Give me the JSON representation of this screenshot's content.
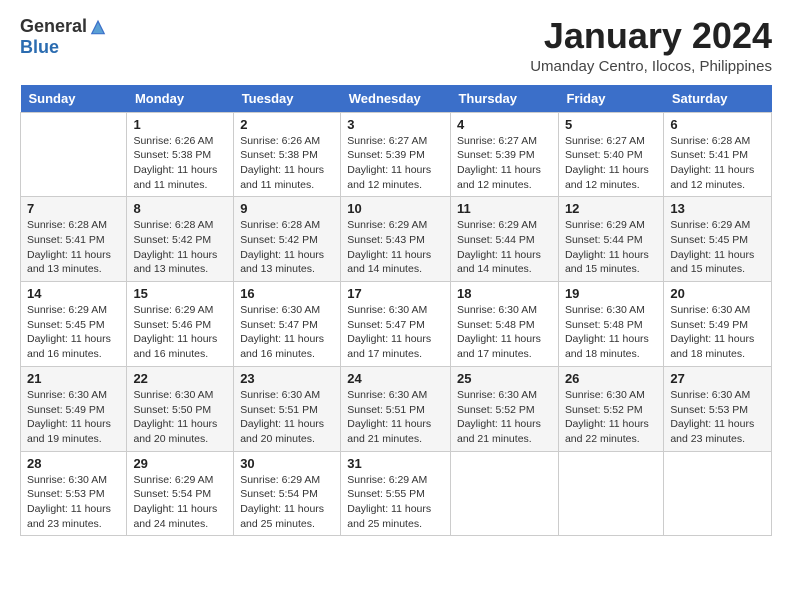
{
  "logo": {
    "general": "General",
    "blue": "Blue"
  },
  "title": "January 2024",
  "subtitle": "Umanday Centro, Ilocos, Philippines",
  "days_of_week": [
    "Sunday",
    "Monday",
    "Tuesday",
    "Wednesday",
    "Thursday",
    "Friday",
    "Saturday"
  ],
  "weeks": [
    [
      {
        "day": "",
        "info": ""
      },
      {
        "day": "1",
        "info": "Sunrise: 6:26 AM\nSunset: 5:38 PM\nDaylight: 11 hours and 11 minutes."
      },
      {
        "day": "2",
        "info": "Sunrise: 6:26 AM\nSunset: 5:38 PM\nDaylight: 11 hours and 11 minutes."
      },
      {
        "day": "3",
        "info": "Sunrise: 6:27 AM\nSunset: 5:39 PM\nDaylight: 11 hours and 12 minutes."
      },
      {
        "day": "4",
        "info": "Sunrise: 6:27 AM\nSunset: 5:39 PM\nDaylight: 11 hours and 12 minutes."
      },
      {
        "day": "5",
        "info": "Sunrise: 6:27 AM\nSunset: 5:40 PM\nDaylight: 11 hours and 12 minutes."
      },
      {
        "day": "6",
        "info": "Sunrise: 6:28 AM\nSunset: 5:41 PM\nDaylight: 11 hours and 12 minutes."
      }
    ],
    [
      {
        "day": "7",
        "info": "Sunrise: 6:28 AM\nSunset: 5:41 PM\nDaylight: 11 hours and 13 minutes."
      },
      {
        "day": "8",
        "info": "Sunrise: 6:28 AM\nSunset: 5:42 PM\nDaylight: 11 hours and 13 minutes."
      },
      {
        "day": "9",
        "info": "Sunrise: 6:28 AM\nSunset: 5:42 PM\nDaylight: 11 hours and 13 minutes."
      },
      {
        "day": "10",
        "info": "Sunrise: 6:29 AM\nSunset: 5:43 PM\nDaylight: 11 hours and 14 minutes."
      },
      {
        "day": "11",
        "info": "Sunrise: 6:29 AM\nSunset: 5:44 PM\nDaylight: 11 hours and 14 minutes."
      },
      {
        "day": "12",
        "info": "Sunrise: 6:29 AM\nSunset: 5:44 PM\nDaylight: 11 hours and 15 minutes."
      },
      {
        "day": "13",
        "info": "Sunrise: 6:29 AM\nSunset: 5:45 PM\nDaylight: 11 hours and 15 minutes."
      }
    ],
    [
      {
        "day": "14",
        "info": "Sunrise: 6:29 AM\nSunset: 5:45 PM\nDaylight: 11 hours and 16 minutes."
      },
      {
        "day": "15",
        "info": "Sunrise: 6:29 AM\nSunset: 5:46 PM\nDaylight: 11 hours and 16 minutes."
      },
      {
        "day": "16",
        "info": "Sunrise: 6:30 AM\nSunset: 5:47 PM\nDaylight: 11 hours and 16 minutes."
      },
      {
        "day": "17",
        "info": "Sunrise: 6:30 AM\nSunset: 5:47 PM\nDaylight: 11 hours and 17 minutes."
      },
      {
        "day": "18",
        "info": "Sunrise: 6:30 AM\nSunset: 5:48 PM\nDaylight: 11 hours and 17 minutes."
      },
      {
        "day": "19",
        "info": "Sunrise: 6:30 AM\nSunset: 5:48 PM\nDaylight: 11 hours and 18 minutes."
      },
      {
        "day": "20",
        "info": "Sunrise: 6:30 AM\nSunset: 5:49 PM\nDaylight: 11 hours and 18 minutes."
      }
    ],
    [
      {
        "day": "21",
        "info": "Sunrise: 6:30 AM\nSunset: 5:49 PM\nDaylight: 11 hours and 19 minutes."
      },
      {
        "day": "22",
        "info": "Sunrise: 6:30 AM\nSunset: 5:50 PM\nDaylight: 11 hours and 20 minutes."
      },
      {
        "day": "23",
        "info": "Sunrise: 6:30 AM\nSunset: 5:51 PM\nDaylight: 11 hours and 20 minutes."
      },
      {
        "day": "24",
        "info": "Sunrise: 6:30 AM\nSunset: 5:51 PM\nDaylight: 11 hours and 21 minutes."
      },
      {
        "day": "25",
        "info": "Sunrise: 6:30 AM\nSunset: 5:52 PM\nDaylight: 11 hours and 21 minutes."
      },
      {
        "day": "26",
        "info": "Sunrise: 6:30 AM\nSunset: 5:52 PM\nDaylight: 11 hours and 22 minutes."
      },
      {
        "day": "27",
        "info": "Sunrise: 6:30 AM\nSunset: 5:53 PM\nDaylight: 11 hours and 23 minutes."
      }
    ],
    [
      {
        "day": "28",
        "info": "Sunrise: 6:30 AM\nSunset: 5:53 PM\nDaylight: 11 hours and 23 minutes."
      },
      {
        "day": "29",
        "info": "Sunrise: 6:29 AM\nSunset: 5:54 PM\nDaylight: 11 hours and 24 minutes."
      },
      {
        "day": "30",
        "info": "Sunrise: 6:29 AM\nSunset: 5:54 PM\nDaylight: 11 hours and 25 minutes."
      },
      {
        "day": "31",
        "info": "Sunrise: 6:29 AM\nSunset: 5:55 PM\nDaylight: 11 hours and 25 minutes."
      },
      {
        "day": "",
        "info": ""
      },
      {
        "day": "",
        "info": ""
      },
      {
        "day": "",
        "info": ""
      }
    ]
  ]
}
